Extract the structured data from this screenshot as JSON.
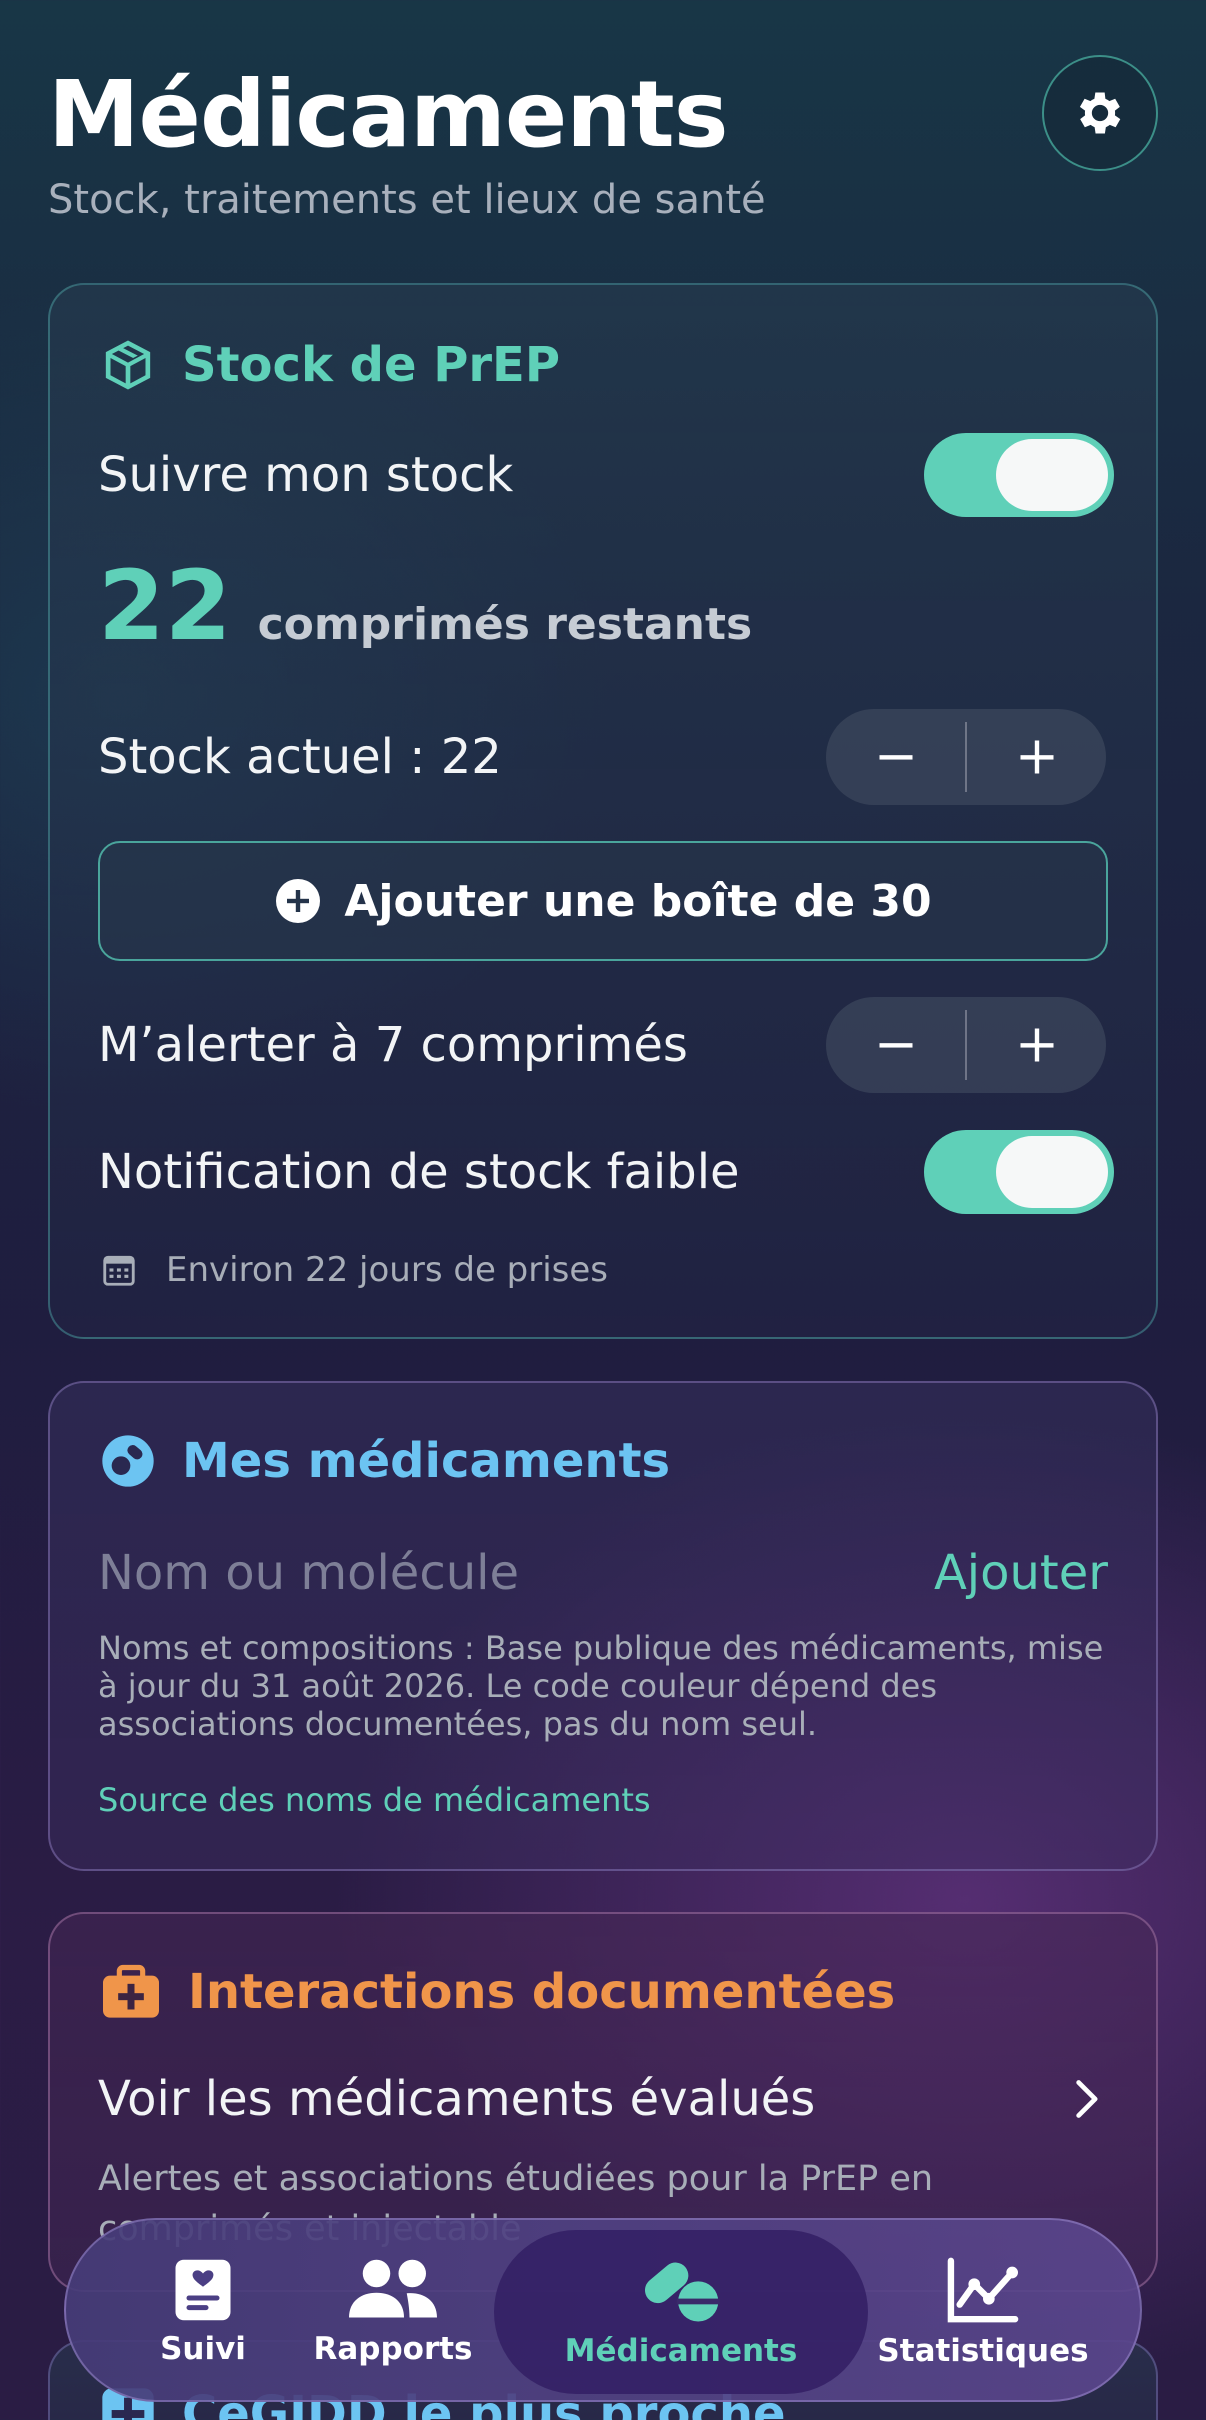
{
  "header": {
    "title": "Médicaments",
    "subtitle": "Stock, traitements et lieux de santé"
  },
  "stock_card": {
    "title": "Stock de PrEP",
    "track_label": "Suivre mon stock",
    "track_enabled": true,
    "remaining_count": "22",
    "remaining_suffix": "comprimés restants",
    "current_stock_label": "Stock actuel : 22",
    "add_box_label": "Ajouter une boîte de 30",
    "alert_label": "M’alerter à 7 comprimés",
    "low_stock_label": "Notification de stock faible",
    "low_stock_enabled": true,
    "estimate": "Environ 22 jours de prises"
  },
  "meds_card": {
    "title": "Mes médicaments",
    "input_placeholder": "Nom ou molécule",
    "add_label": "Ajouter",
    "info": "Noms et compositions : Base publique des médicaments, mise à jour du 31 août 2026. Le code couleur dépend des associations documentées, pas du nom seul.",
    "source_link": "Source des noms de médicaments"
  },
  "interactions_card": {
    "title": "Interactions documentées",
    "row_label": "Voir les médicaments évalués",
    "description": "Alertes et associations étudiées pour la PrEP en comprimés et injectable"
  },
  "cegidd_card": {
    "title": "CeGIDD le plus proche"
  },
  "nav": {
    "items": [
      {
        "label": "Suivi"
      },
      {
        "label": "Rapports"
      },
      {
        "label": "Médicaments"
      },
      {
        "label": "Statistiques"
      }
    ],
    "active": "Médicaments"
  },
  "colors": {
    "teal": "#5fd0b8",
    "blue": "#6cc4f2",
    "orange": "#f0954a",
    "link": "#5fd0b8"
  }
}
